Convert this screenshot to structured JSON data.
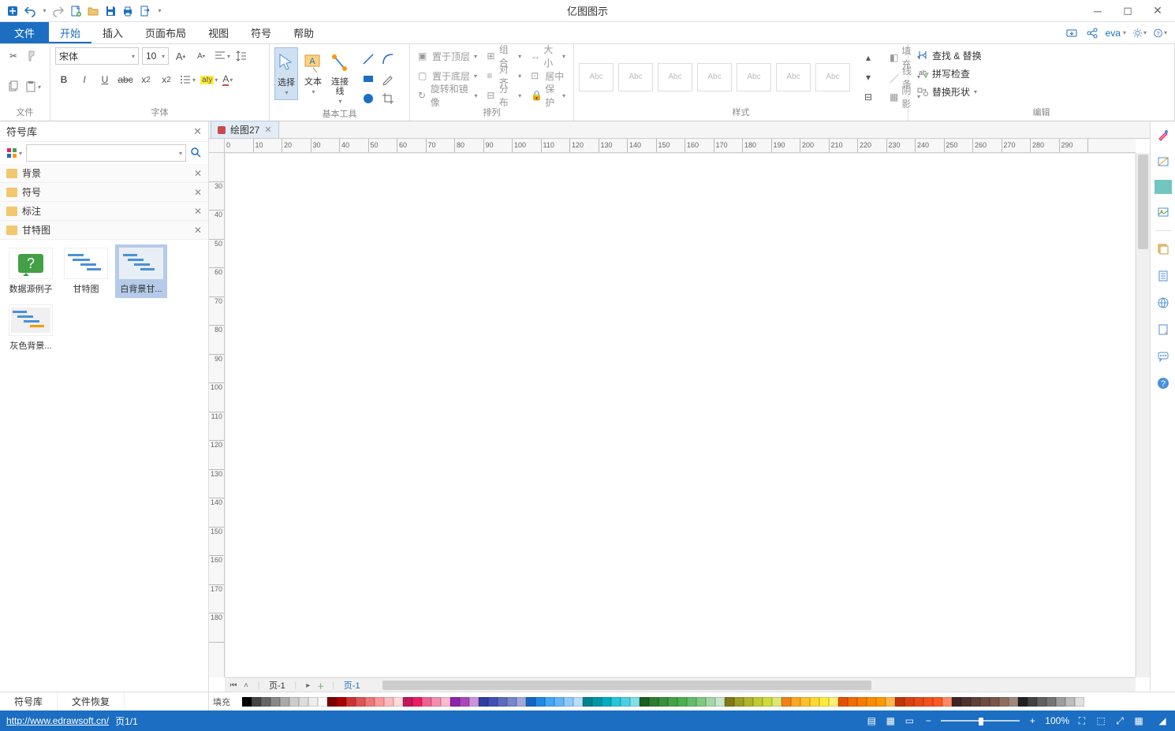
{
  "title": "亿图图示",
  "qat_dropdown": "▾",
  "menu": {
    "file": "文件",
    "items": [
      "开始",
      "插入",
      "页面布局",
      "视图",
      "符号",
      "帮助"
    ],
    "active": 0
  },
  "menu_right": {
    "user": "eva"
  },
  "ribbon": {
    "clipboard": {
      "label": "文件"
    },
    "font": {
      "label": "字体",
      "name": "宋体",
      "size": "10"
    },
    "tools": {
      "label": "基本工具",
      "select": "选择",
      "text": "文本",
      "connector": "连接线"
    },
    "arrange": {
      "label": "排列",
      "top": "置于顶层",
      "bottom": "置于底层",
      "rotate": "旋转和镜像",
      "group": "组合",
      "align": "对齐",
      "distribute": "分布",
      "size": "大小",
      "center": "居中",
      "protect": "保护"
    },
    "styles": {
      "label": "样式",
      "sample": "Abc",
      "fill": "填充",
      "line": "线条",
      "shadow": "阴影"
    },
    "edit": {
      "label": "编辑",
      "find": "查找 & 替换",
      "spell": "拼写检查",
      "replace_shape": "替换形状"
    }
  },
  "sidebar": {
    "title": "符号库",
    "cats": [
      "背景",
      "符号",
      "标注",
      "甘特图"
    ],
    "shapes": [
      {
        "label": "数据源例子"
      },
      {
        "label": "甘特图"
      },
      {
        "label": "白背景甘..."
      },
      {
        "label": "灰色背景..."
      }
    ]
  },
  "doc": {
    "tab": "绘图27",
    "page_tab1": "页-1",
    "page_tab2": "页-1"
  },
  "hruler": [
    "0",
    "10",
    "20",
    "30",
    "40",
    "50",
    "60",
    "70",
    "80",
    "90",
    "100",
    "110",
    "120",
    "130",
    "140",
    "150",
    "160",
    "170",
    "180",
    "190",
    "200",
    "210",
    "220",
    "230",
    "240",
    "250",
    "260",
    "270",
    "280",
    "290"
  ],
  "vruler": [
    "",
    "30",
    "40",
    "50",
    "60",
    "70",
    "80",
    "90",
    "100",
    "110",
    "120",
    "130",
    "140",
    "150",
    "160",
    "170",
    "180"
  ],
  "bottom_tabs": {
    "lib": "符号库",
    "recover": "文件恢复"
  },
  "colorbar_label": "填充",
  "status": {
    "url": "http://www.edrawsoft.cn/",
    "page": "页1/1",
    "zoom": "100%"
  },
  "colors": [
    "#000",
    "#444",
    "#666",
    "#888",
    "#aaa",
    "#ccc",
    "#ddd",
    "#eee",
    "#fff",
    "#7b0000",
    "#a00",
    "#c33",
    "#d55",
    "#e77",
    "#f99",
    "#fbb",
    "#fdd",
    "#c2185b",
    "#e91e63",
    "#f06292",
    "#f48fb1",
    "#f8bbd0",
    "#8e24aa",
    "#ab47bc",
    "#ce93d8",
    "#303f9f",
    "#3f51b5",
    "#5c6bc0",
    "#7986cb",
    "#9fa8da",
    "#1565c0",
    "#1e88e5",
    "#42a5f5",
    "#64b5f6",
    "#90caf9",
    "#bbdefb",
    "#00838f",
    "#0097a7",
    "#00acc1",
    "#26c6da",
    "#4dd0e1",
    "#80deea",
    "#1b5e20",
    "#2e7d32",
    "#388e3c",
    "#43a047",
    "#4caf50",
    "#66bb6a",
    "#81c784",
    "#a5d6a7",
    "#c8e6c9",
    "#827717",
    "#9e9d24",
    "#afb42b",
    "#c0ca33",
    "#cddc39",
    "#dce775",
    "#f57f17",
    "#f9a825",
    "#fbc02d",
    "#fdd835",
    "#ffeb3b",
    "#fff176",
    "#e65100",
    "#ef6c00",
    "#f57c00",
    "#fb8c00",
    "#ff9800",
    "#ffb74d",
    "#bf360c",
    "#d84315",
    "#e64a19",
    "#f4511e",
    "#ff5722",
    "#ff8a65",
    "#3e2723",
    "#4e342e",
    "#5d4037",
    "#6d4c41",
    "#795548",
    "#8d6e63",
    "#a1887f",
    "#212121",
    "#424242",
    "#616161",
    "#757575",
    "#9e9e9e",
    "#bdbdbd",
    "#e0e0e0"
  ]
}
